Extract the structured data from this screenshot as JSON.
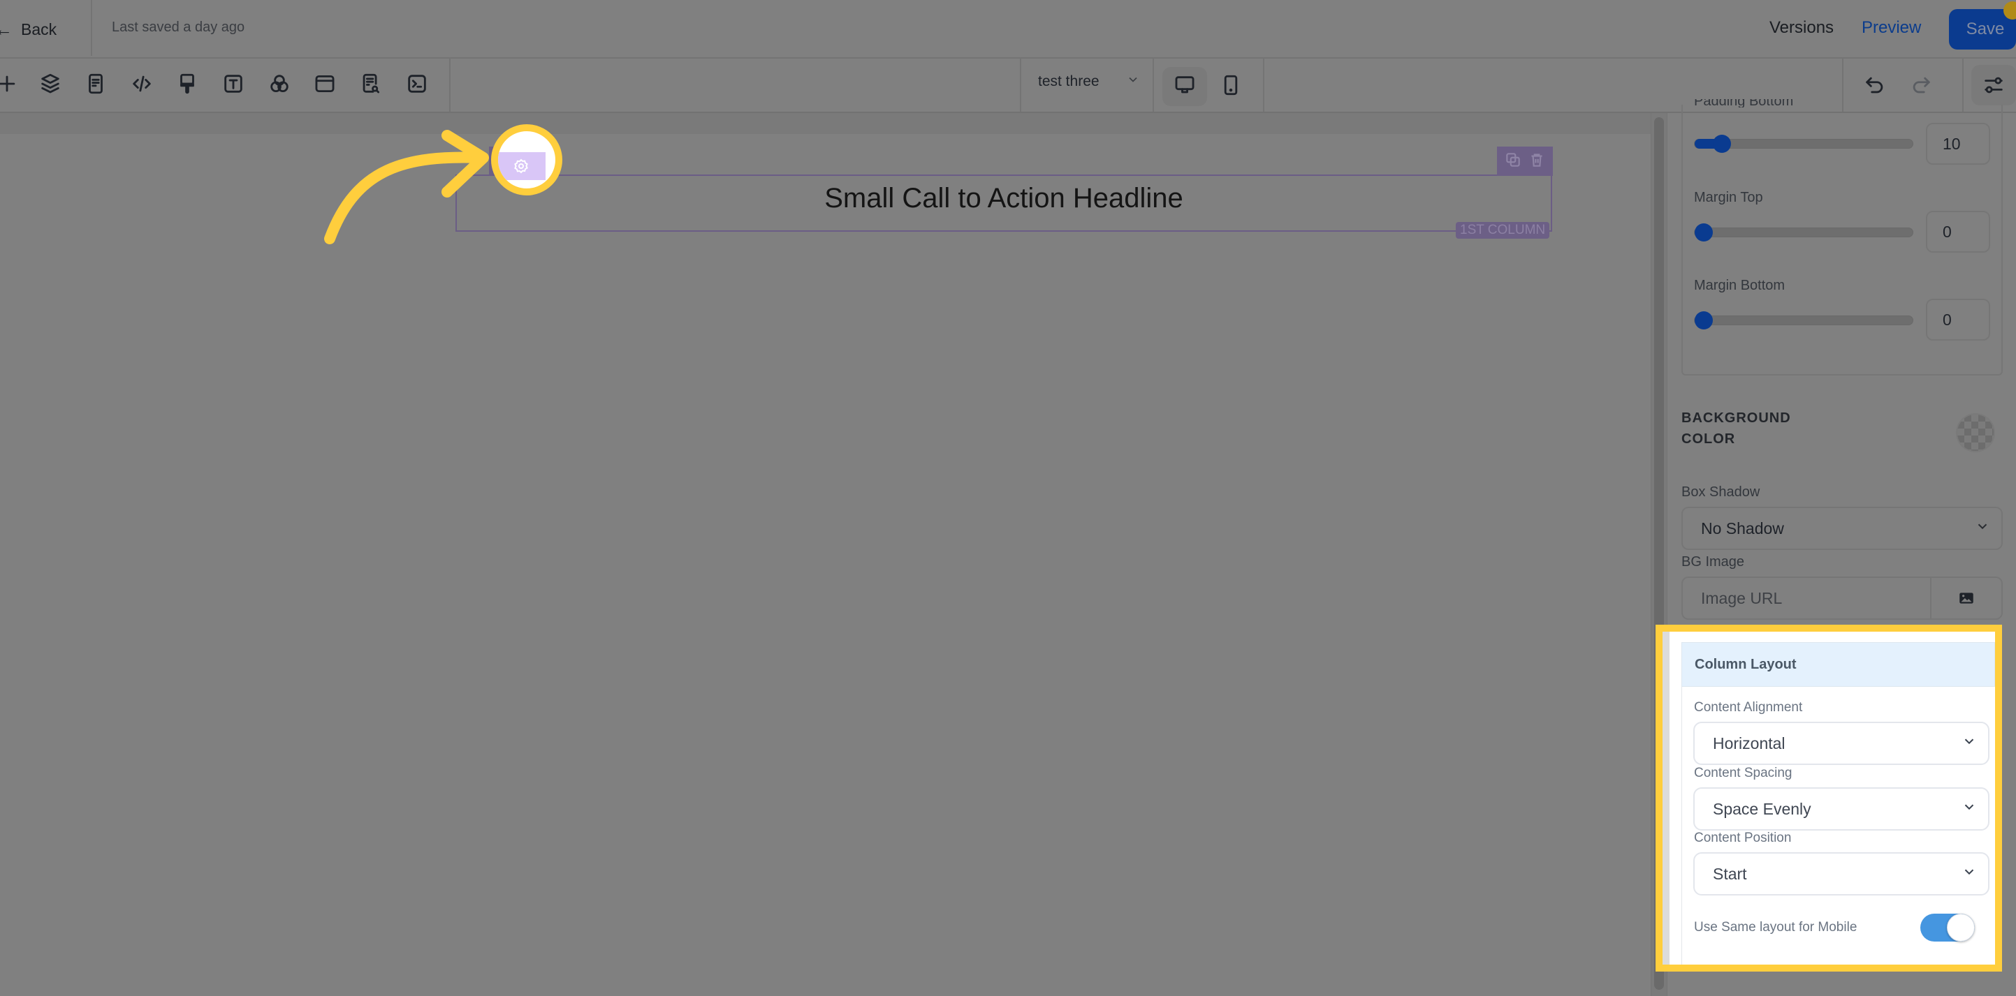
{
  "header": {
    "back_label": "Back",
    "last_saved": "Last saved a day ago",
    "versions_label": "Versions",
    "preview_label": "Preview",
    "save_label": "Save"
  },
  "toolbar": {
    "icons": [
      "plus-icon",
      "layers-icon",
      "page-icon",
      "code-icon",
      "paint-brush-icon",
      "text-icon",
      "color-circles-icon",
      "section-icon",
      "page-search-icon",
      "terminal-icon"
    ],
    "page_select": {
      "value": "test three"
    },
    "devices": [
      {
        "name": "desktop",
        "active": true
      },
      {
        "name": "mobile",
        "active": false
      }
    ],
    "undo_label": "undo",
    "redo_label": "redo"
  },
  "canvas": {
    "headline": "Small Call to Action Headline",
    "column_label": "1ST COLUMN"
  },
  "panel": {
    "padding_bottom": {
      "label": "Padding Bottom",
      "value": "10",
      "slider_fraction": 0.1
    },
    "margin_top": {
      "label": "Margin Top",
      "value": "0",
      "slider_fraction": 0
    },
    "margin_bottom": {
      "label": "Margin Bottom",
      "value": "0",
      "slider_fraction": 0
    },
    "background_color": {
      "label_line1": "BACKGROUND",
      "label_line2": "COLOR",
      "value": "transparent"
    },
    "box_shadow": {
      "label": "Box Shadow",
      "value": "No Shadow"
    },
    "bg_image": {
      "label": "BG Image",
      "placeholder": "Image URL"
    },
    "column_layout": {
      "title": "Column Layout",
      "content_alignment": {
        "label": "Content Alignment",
        "value": "Horizontal"
      },
      "content_spacing": {
        "label": "Content Spacing",
        "value": "Space Evenly"
      },
      "content_position": {
        "label": "Content Position",
        "value": "Start"
      },
      "same_layout_mobile": {
        "label": "Use Same layout for Mobile",
        "enabled": true
      }
    }
  },
  "colors": {
    "accent_blue": "#0b3b8f",
    "highlight_yellow": "#ffce3d",
    "element_purple": "#6c5f86",
    "toggle_on": "#4596e0"
  }
}
